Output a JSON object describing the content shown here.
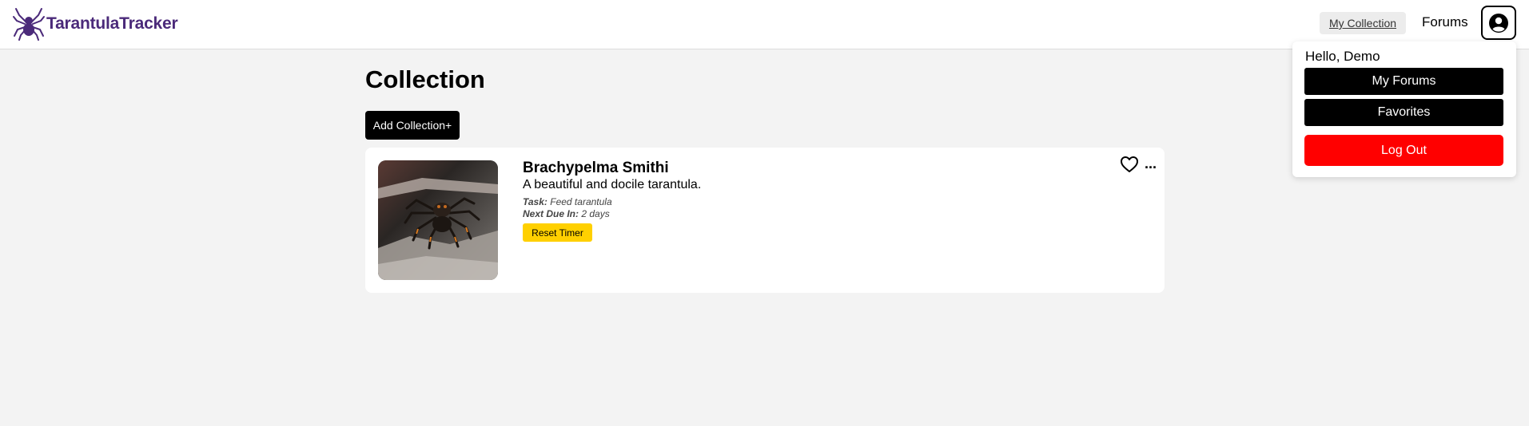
{
  "header": {
    "brand": "TarantulaTracker",
    "nav": {
      "my_collection": "My Collection",
      "forums": "Forums"
    }
  },
  "dropdown": {
    "greeting": "Hello, Demo",
    "my_forums": "My Forums",
    "favorites": "Favorites",
    "logout": "Log Out"
  },
  "main": {
    "title": "Collection",
    "add_button": "Add Collection+",
    "cards": [
      {
        "name": "Brachypelma Smithi",
        "description": "A beautiful and docile tarantula.",
        "task_label": "Task:",
        "task_value": "Feed tarantula",
        "due_label": "Next Due In:",
        "due_value": "2 days",
        "reset_button": "Reset Timer",
        "more": "..."
      }
    ]
  },
  "icons": {
    "logo": "spider-icon",
    "profile": "user-circle-icon",
    "favorite": "heart-icon",
    "more": "ellipsis-icon"
  },
  "colors": {
    "brand": "#4b2a7a",
    "logout": "#ff0000",
    "reset": "#ffd000",
    "background": "#f3f3f3"
  }
}
